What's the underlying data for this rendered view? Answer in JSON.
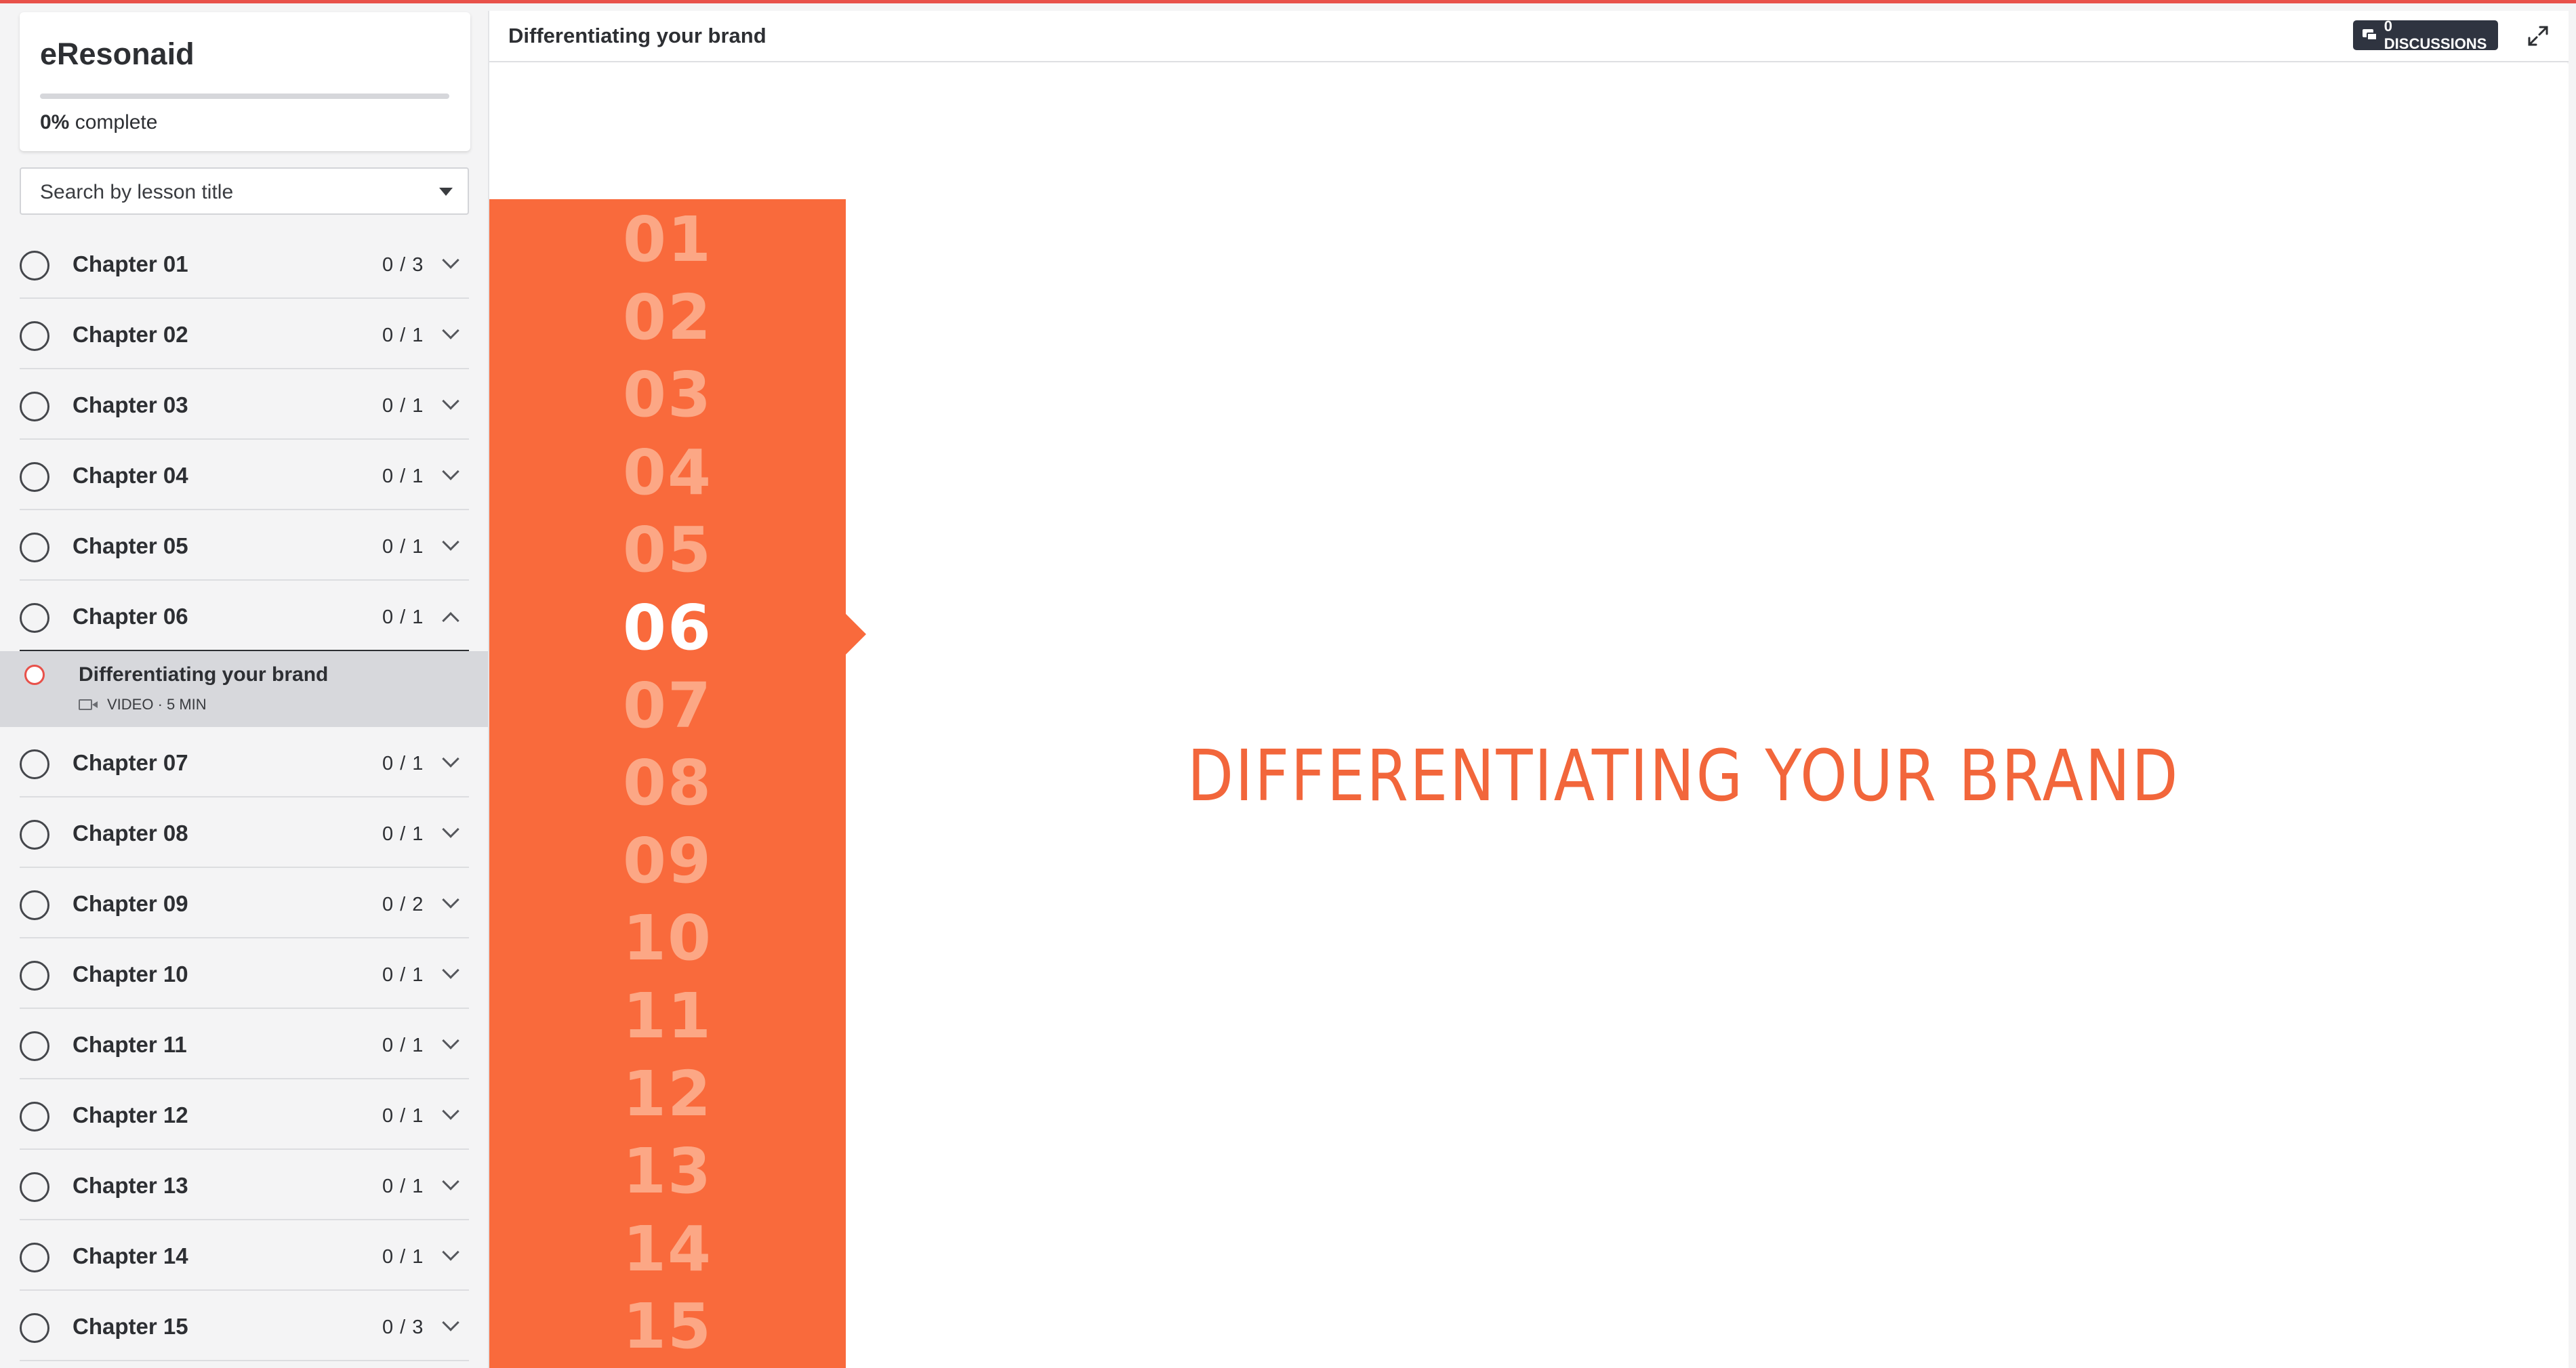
{
  "course": {
    "title": "eResonaid",
    "progress_value": "0%",
    "progress_label": "complete",
    "progress_fraction": 0
  },
  "search": {
    "placeholder": "Search by lesson title"
  },
  "chapters": [
    {
      "title": "Chapter 01",
      "count": "0 / 3"
    },
    {
      "title": "Chapter 02",
      "count": "0 / 1"
    },
    {
      "title": "Chapter 03",
      "count": "0 / 1"
    },
    {
      "title": "Chapter 04",
      "count": "0 / 1"
    },
    {
      "title": "Chapter 05",
      "count": "0 / 1"
    },
    {
      "title": "Chapter 06",
      "count": "0 / 1"
    },
    {
      "title": "Chapter 07",
      "count": "0 / 1"
    },
    {
      "title": "Chapter 08",
      "count": "0 / 1"
    },
    {
      "title": "Chapter 09",
      "count": "0 / 2"
    },
    {
      "title": "Chapter 10",
      "count": "0 / 1"
    },
    {
      "title": "Chapter 11",
      "count": "0 / 1"
    },
    {
      "title": "Chapter 12",
      "count": "0 / 1"
    },
    {
      "title": "Chapter 13",
      "count": "0 / 1"
    },
    {
      "title": "Chapter 14",
      "count": "0 / 1"
    },
    {
      "title": "Chapter 15",
      "count": "0 / 3"
    }
  ],
  "open_chapter_index": 5,
  "lesson": {
    "title": "Differentiating your brand",
    "meta": "VIDEO · 5 MIN"
  },
  "header": {
    "title": "Differentiating your brand",
    "discussions_label": "0 DISCUSSIONS"
  },
  "slide": {
    "numbers": [
      "01",
      "02",
      "03",
      "04",
      "05",
      "06",
      "07",
      "08",
      "09",
      "10",
      "11",
      "12",
      "13",
      "14",
      "15"
    ],
    "active_index": 5,
    "title": "DIFFERENTIATING YOUR BRAND"
  },
  "colors": {
    "accent": "#e8514a",
    "slide_orange": "#f96a3c",
    "number_faded": "#fca785",
    "button_dark": "#2f3440"
  }
}
